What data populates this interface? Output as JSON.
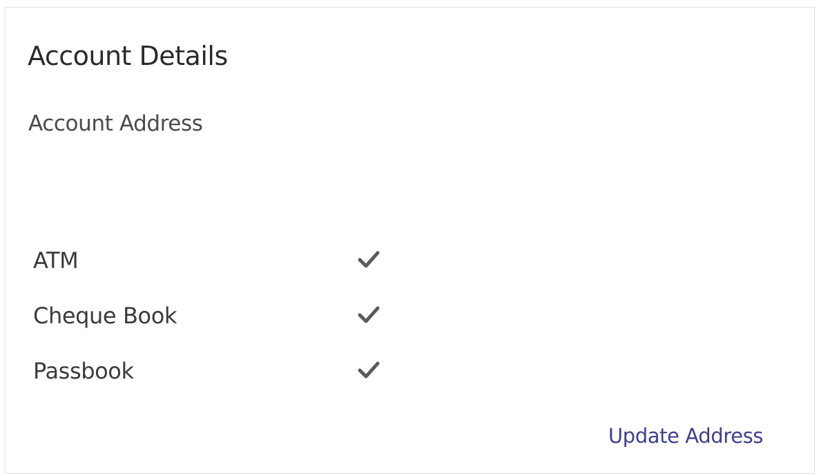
{
  "card": {
    "title": "Account Details",
    "section_label": "Account Address",
    "features": [
      {
        "label": "ATM",
        "icon": "check-icon",
        "checked": true
      },
      {
        "label": "Cheque Book",
        "icon": "check-icon",
        "checked": true
      },
      {
        "label": "Passbook",
        "icon": "check-icon",
        "checked": true
      }
    ],
    "update_link": "Update Address"
  },
  "colors": {
    "title": "#2a2a2a",
    "text": "#3a3a3a",
    "check": "#5a5a5a",
    "link": "#3f3f8f",
    "border": "#e0e0e0"
  }
}
